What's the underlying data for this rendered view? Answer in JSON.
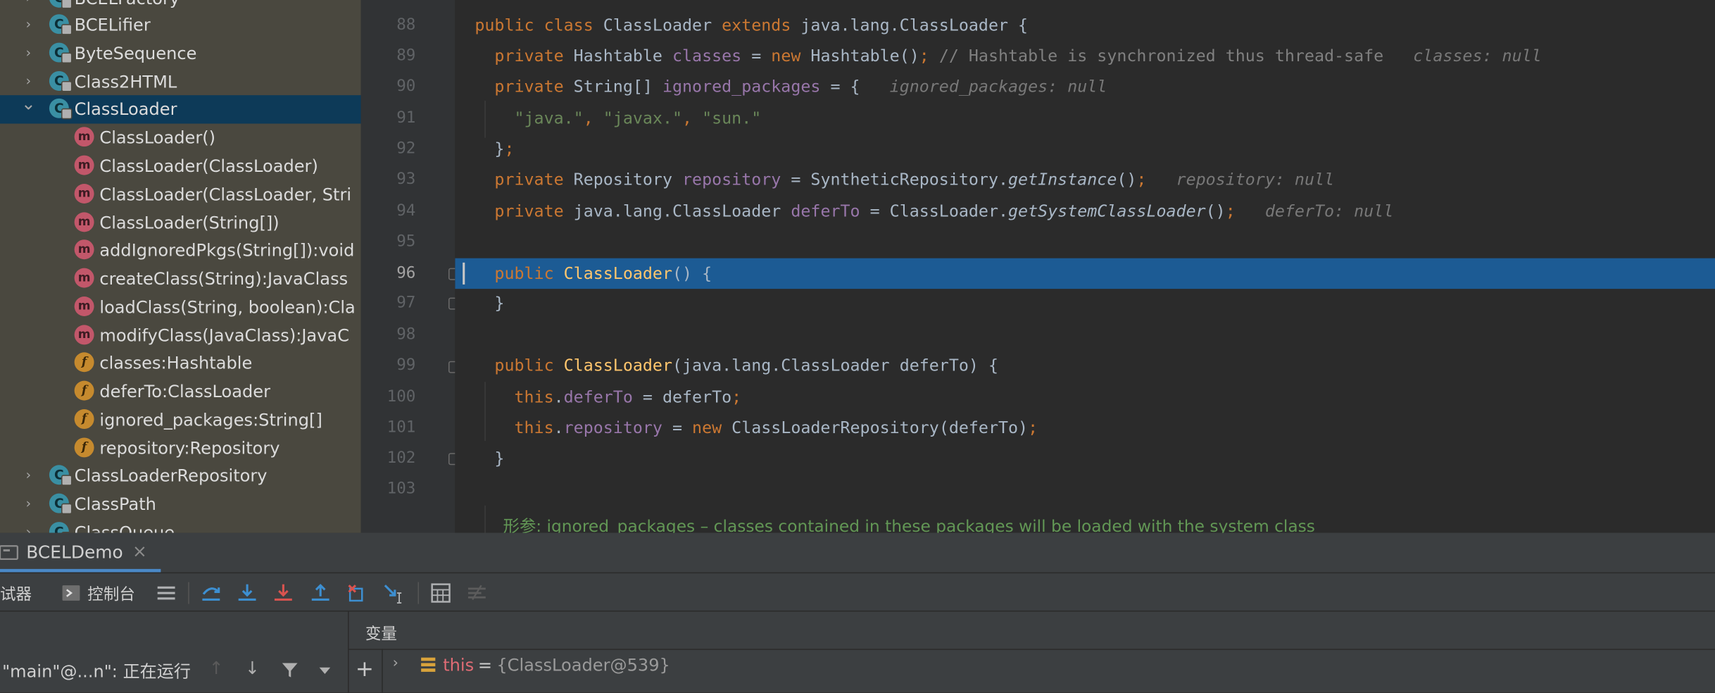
{
  "project_tree": {
    "items": [
      {
        "label": "BCELFactory",
        "kind": "class"
      },
      {
        "label": "BCELifier",
        "kind": "class"
      },
      {
        "label": "ByteSequence",
        "kind": "class"
      },
      {
        "label": "Class2HTML",
        "kind": "class"
      },
      {
        "label": "ClassLoader",
        "kind": "class",
        "expanded": true,
        "selected": true
      },
      {
        "label": "ClassLoader()",
        "kind": "method"
      },
      {
        "label": "ClassLoader(ClassLoader)",
        "kind": "method"
      },
      {
        "label": "ClassLoader(ClassLoader, Stri",
        "kind": "method"
      },
      {
        "label": "ClassLoader(String[])",
        "kind": "method"
      },
      {
        "label": "addIgnoredPkgs(String[]):void",
        "kind": "method"
      },
      {
        "label": "createClass(String):JavaClass",
        "kind": "method"
      },
      {
        "label": "loadClass(String, boolean):Cla",
        "kind": "method"
      },
      {
        "label": "modifyClass(JavaClass):JavaC",
        "kind": "method"
      },
      {
        "label": "classes:Hashtable",
        "kind": "field"
      },
      {
        "label": "deferTo:ClassLoader",
        "kind": "field"
      },
      {
        "label": "ignored_packages:String[]",
        "kind": "field"
      },
      {
        "label": "repository:Repository",
        "kind": "field"
      },
      {
        "label": "ClassLoaderRepository",
        "kind": "class"
      },
      {
        "label": "ClassPath",
        "kind": "class"
      },
      {
        "label": "ClassQueue",
        "kind": "class"
      }
    ],
    "icon_letters": {
      "class": "C",
      "method": "m",
      "field": "f"
    }
  },
  "editor": {
    "line_numbers": [
      "88",
      "89",
      "90",
      "91",
      "92",
      "93",
      "94",
      "95",
      "96",
      "97",
      "98",
      "99",
      "100",
      "101",
      "102",
      "103"
    ],
    "current_line": "96",
    "tokens": {
      "public": "public",
      "class": "class",
      "extends": "extends",
      "private": "private",
      "new": "new",
      "this": "this",
      "ClassLoader": "ClassLoader",
      "java_lang_ClassLoader": "java.lang.ClassLoader",
      "Hashtable": "Hashtable",
      "classes": "classes",
      "HashtableCtor": "Hashtable",
      "comment_89": "// Hashtable is synchronized thus thread-safe",
      "hint_classes": "classes: null",
      "String_arr": "String[]",
      "ignored_packages": "ignored_packages",
      "hint_ignored": "ignored_packages: null",
      "s_java": "\"java.\"",
      "s_javax": "\"javax.\"",
      "s_sun": "\"sun.\"",
      "Repository": "Repository",
      "repository": "repository",
      "SyntheticRepository": "SyntheticRepository",
      "getInstance": "getInstance",
      "hint_repository": "repository: null",
      "deferTo": "deferTo",
      "getSystemClassLoader": "getSystemClassLoader",
      "hint_deferTo": "deferTo: null",
      "ClassLoaderRepository": "ClassLoaderRepository",
      "doc_line": "形参: ignored_packages – classes contained in these packages will be loaded with the system class"
    }
  },
  "debug": {
    "session_tab": "BCELDemo",
    "debugger_tab": "试器",
    "console_tab": "控制台",
    "frame_thread": "\"main\"@...n\": 正在运行",
    "variables_header": "变量",
    "var_this_name": "this",
    "var_this_eq": "=",
    "var_this_value": "{ClassLoader@539}"
  }
}
